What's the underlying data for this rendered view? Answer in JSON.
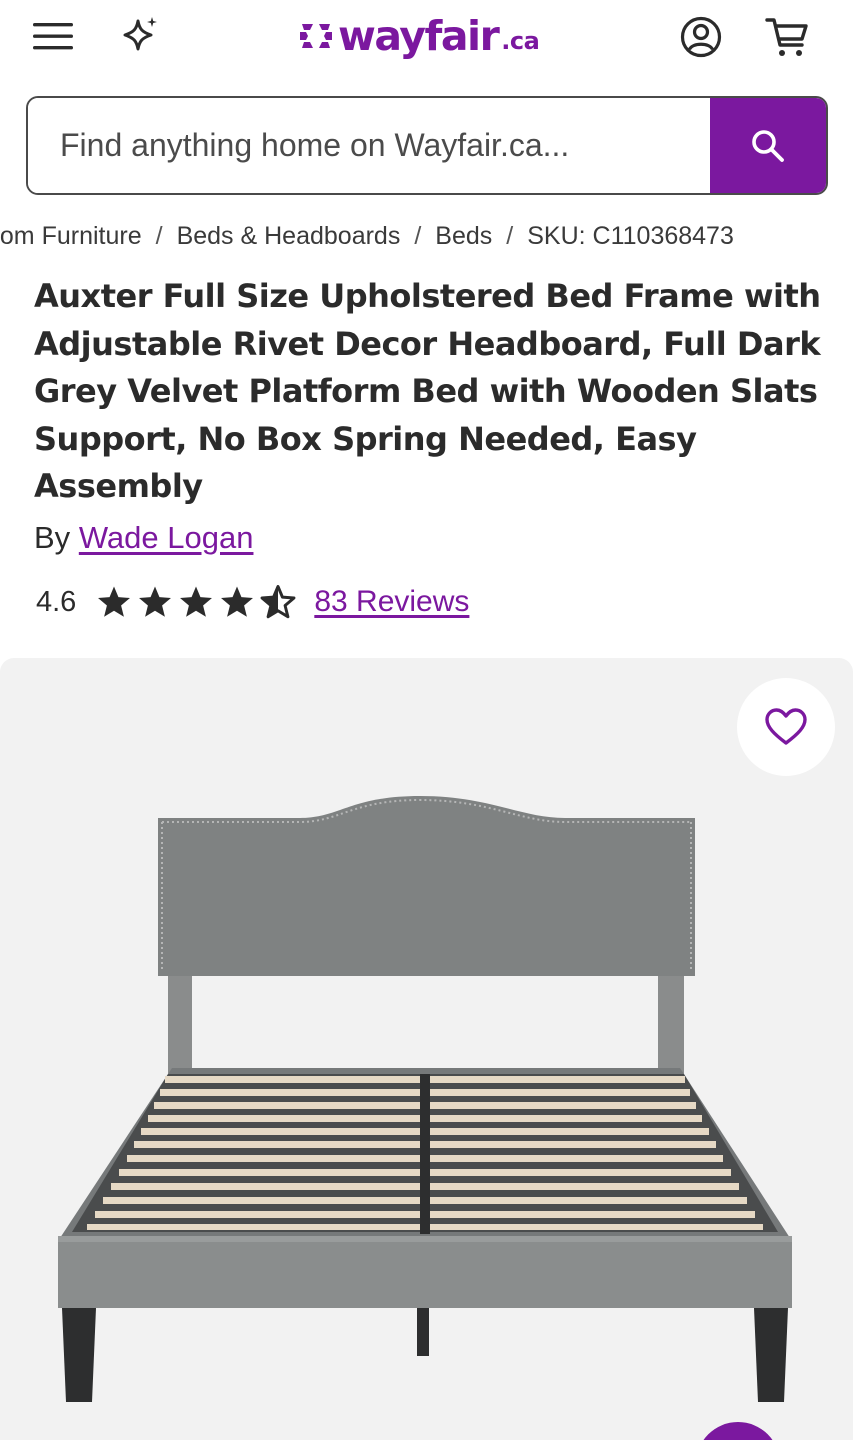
{
  "header": {
    "logo_text": "wayfair",
    "logo_tld": ".ca",
    "icons": [
      "menu-icon",
      "sparkle-icon",
      "account-icon",
      "cart-icon"
    ]
  },
  "search": {
    "placeholder": "Find anything home on Wayfair.ca...",
    "value": ""
  },
  "breadcrumb": {
    "items": [
      "Bedroom Furniture",
      "Beds & Headboards",
      "Beds",
      "SKU: C110368473"
    ],
    "visible_first": "oom Furniture"
  },
  "product": {
    "title": "Auxter Full Size Upholstered Bed Frame with Adjustable Rivet Decor Headboard, Full Dark Grey Velvet Platform Bed with Wooden Slats Support, No Box Spring Needed, Easy Assembly",
    "by_label": "By",
    "brand": "Wade Logan",
    "rating": "4.6",
    "rating_value": 4.6,
    "rating_max": 5,
    "reviews_label": "83 Reviews"
  },
  "colors": {
    "brand": "#7b189f",
    "text": "#2b2b2b",
    "gallery_bg": "#f2f2f2"
  }
}
